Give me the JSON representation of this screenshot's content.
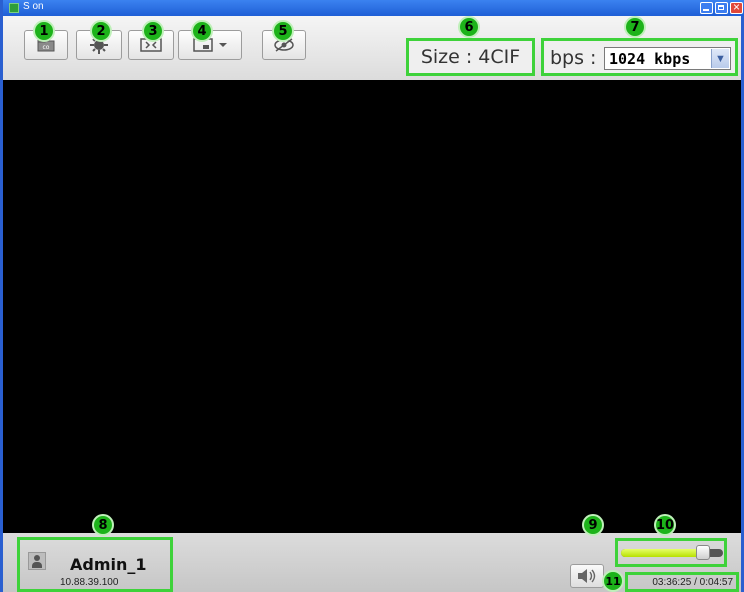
{
  "window": {
    "title": "S      on"
  },
  "toolbar": {
    "buttons": [
      {
        "name": "record-button",
        "icon": "record-icon"
      },
      {
        "name": "settings-button",
        "icon": "gear-icon"
      },
      {
        "name": "fit-screen-button",
        "icon": "fit-screen-icon"
      },
      {
        "name": "layout-dropdown-button",
        "icon": "layout-icon"
      },
      {
        "name": "privacy-button",
        "icon": "hide-eye-icon"
      }
    ],
    "size_text": "Size : 4CIF",
    "bps_label": "bps :",
    "bps_value": "1024 kbps"
  },
  "user": {
    "name": "Admin_1",
    "ip": "10.88.39.100"
  },
  "volume": {
    "level_fraction": 0.85
  },
  "time": {
    "text": "03:36:25  /  0:04:57"
  },
  "callouts": [
    "1",
    "2",
    "3",
    "4",
    "5",
    "6",
    "7",
    "8",
    "9",
    "10",
    "11"
  ],
  "colors": {
    "callout_green": "#1db31a",
    "highlight_border": "#3ed23a",
    "title_blue": "#2a5fd0",
    "video_bg": "#000000"
  }
}
